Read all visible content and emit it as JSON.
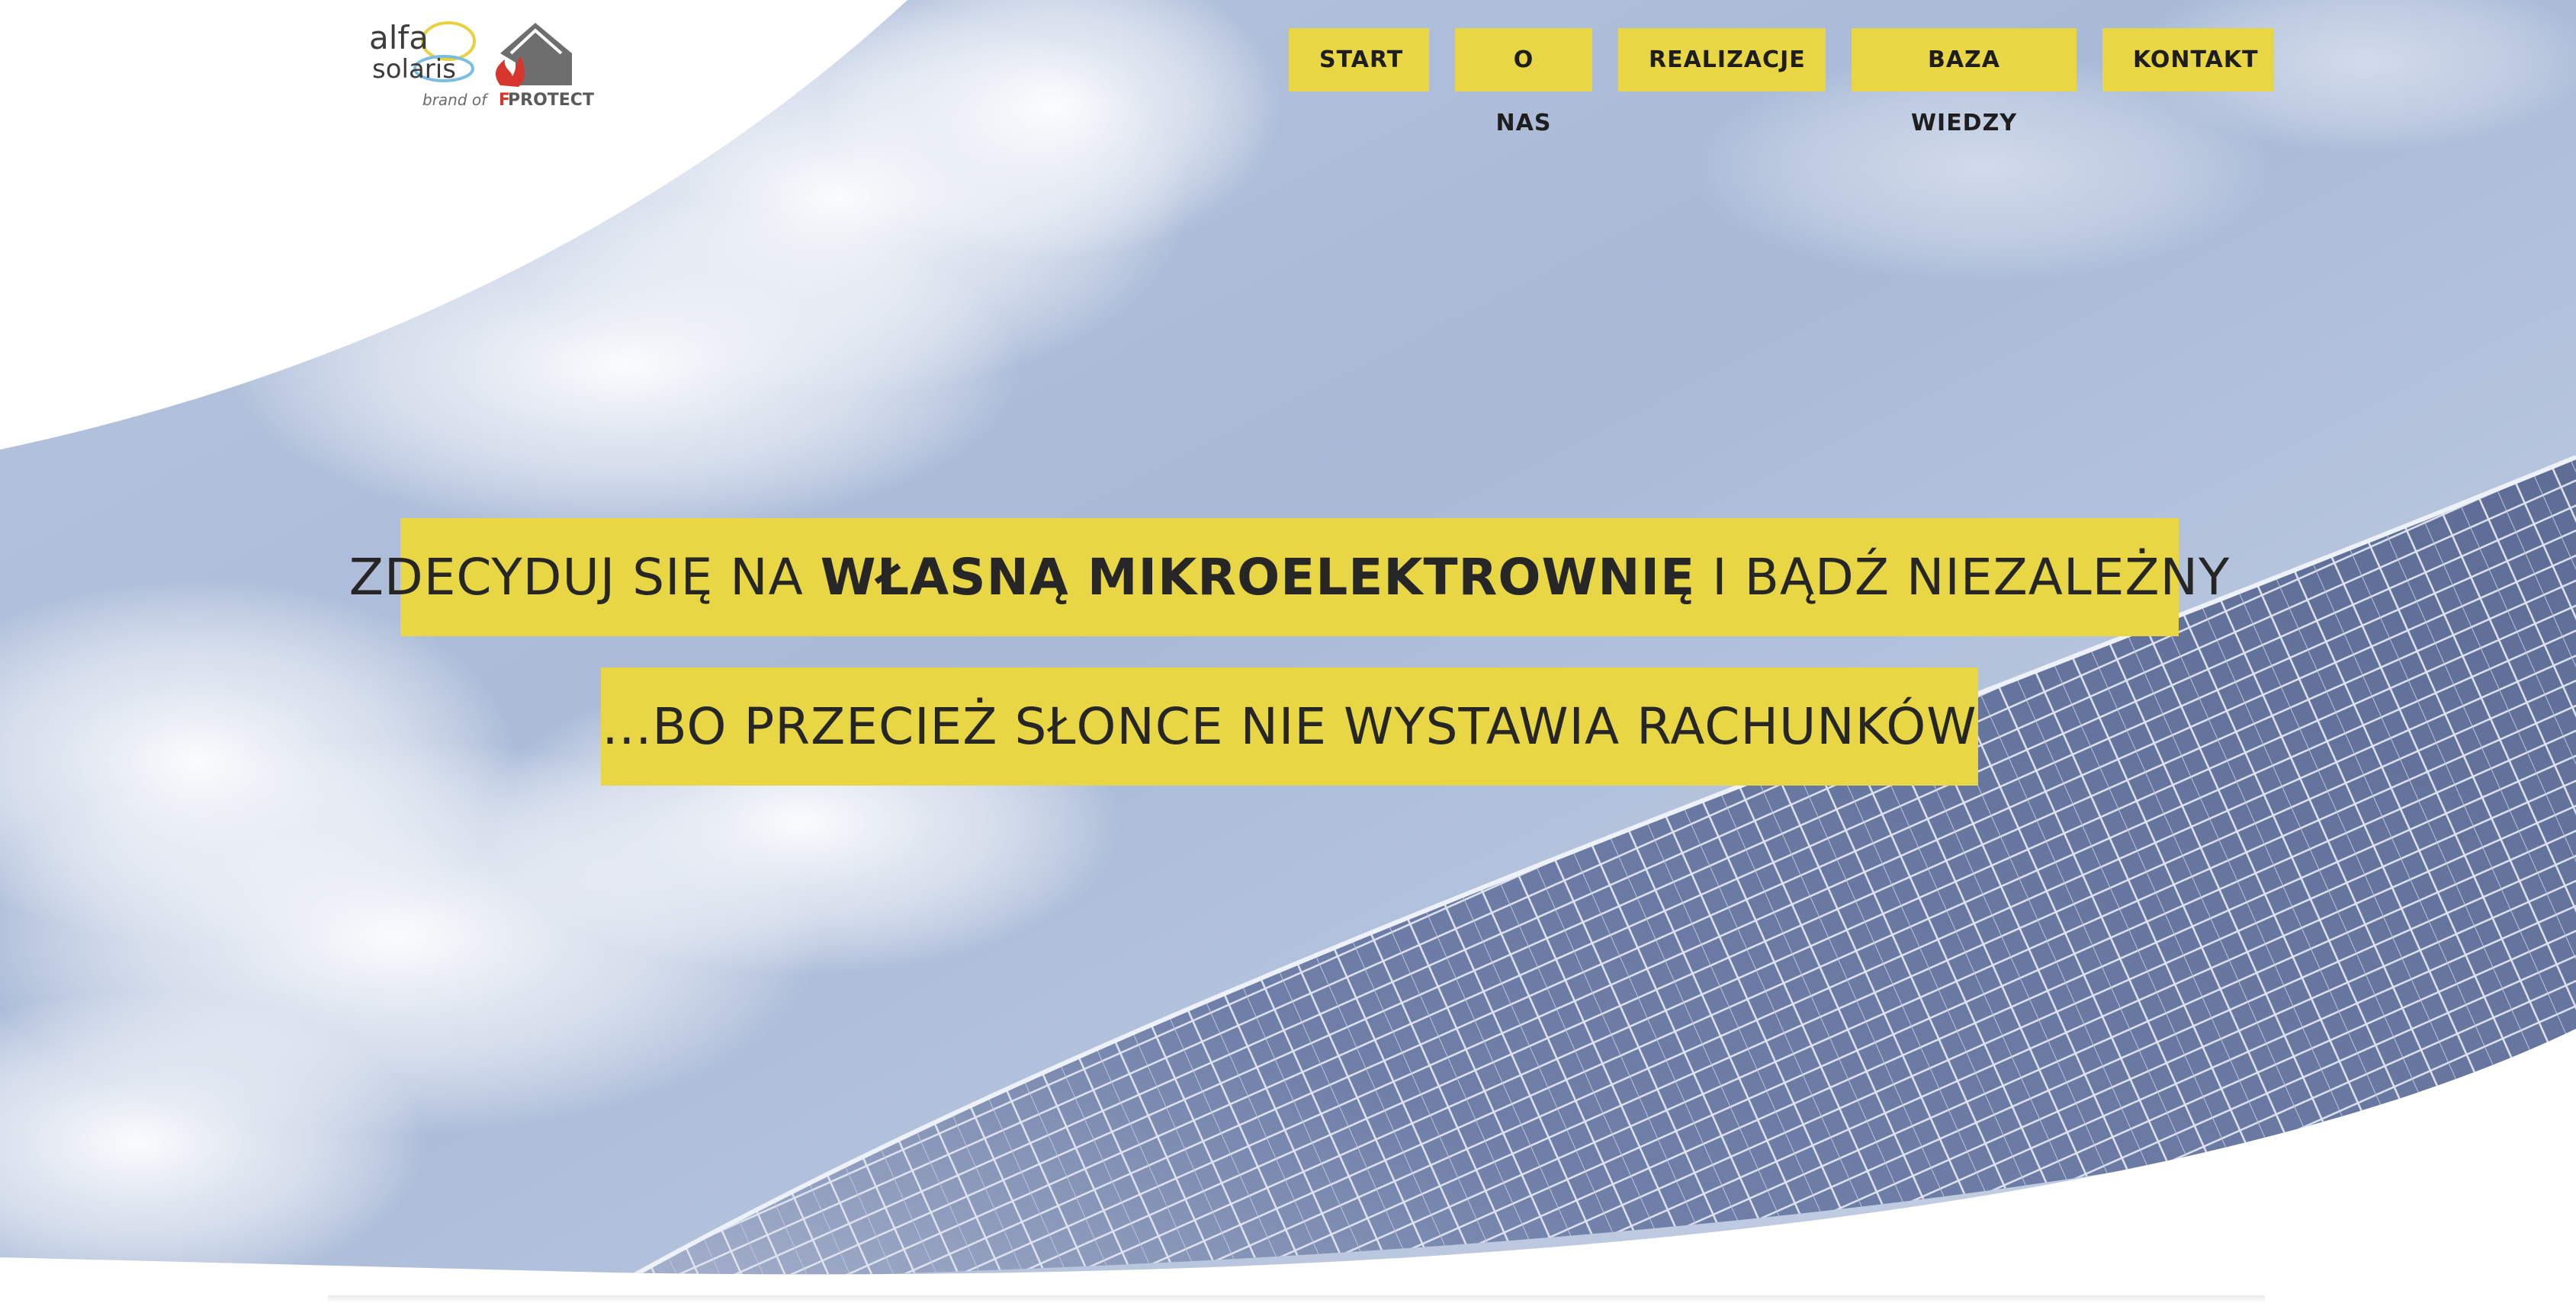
{
  "logo": {
    "line1": "alfa",
    "line2": "solaris",
    "brand_of": "brand of",
    "partner": "PROTECT",
    "partner_prefix": "F"
  },
  "nav": {
    "items": [
      {
        "label": "START"
      },
      {
        "label": "O NAS"
      },
      {
        "label": "REALIZACJE"
      },
      {
        "label": "BAZA WIEDZY"
      },
      {
        "label": "KONTAKT"
      }
    ]
  },
  "hero": {
    "headline1": {
      "before": "ZDECYDUJ SIĘ NA ",
      "bold": "WŁASNĄ MIKROELEKTROWNIĘ",
      "after": " I BĄDŹ NIEZALEŻNY"
    },
    "headline2": "...BO PRZECIEŻ SŁONCE NIE WYSTAWIA RACHUNKÓW"
  },
  "colors": {
    "accent": "#e8d644",
    "text_dark": "#262626",
    "sky": "#9fb2d2",
    "panel": "#4f5f8f",
    "background": "#ffffff"
  }
}
